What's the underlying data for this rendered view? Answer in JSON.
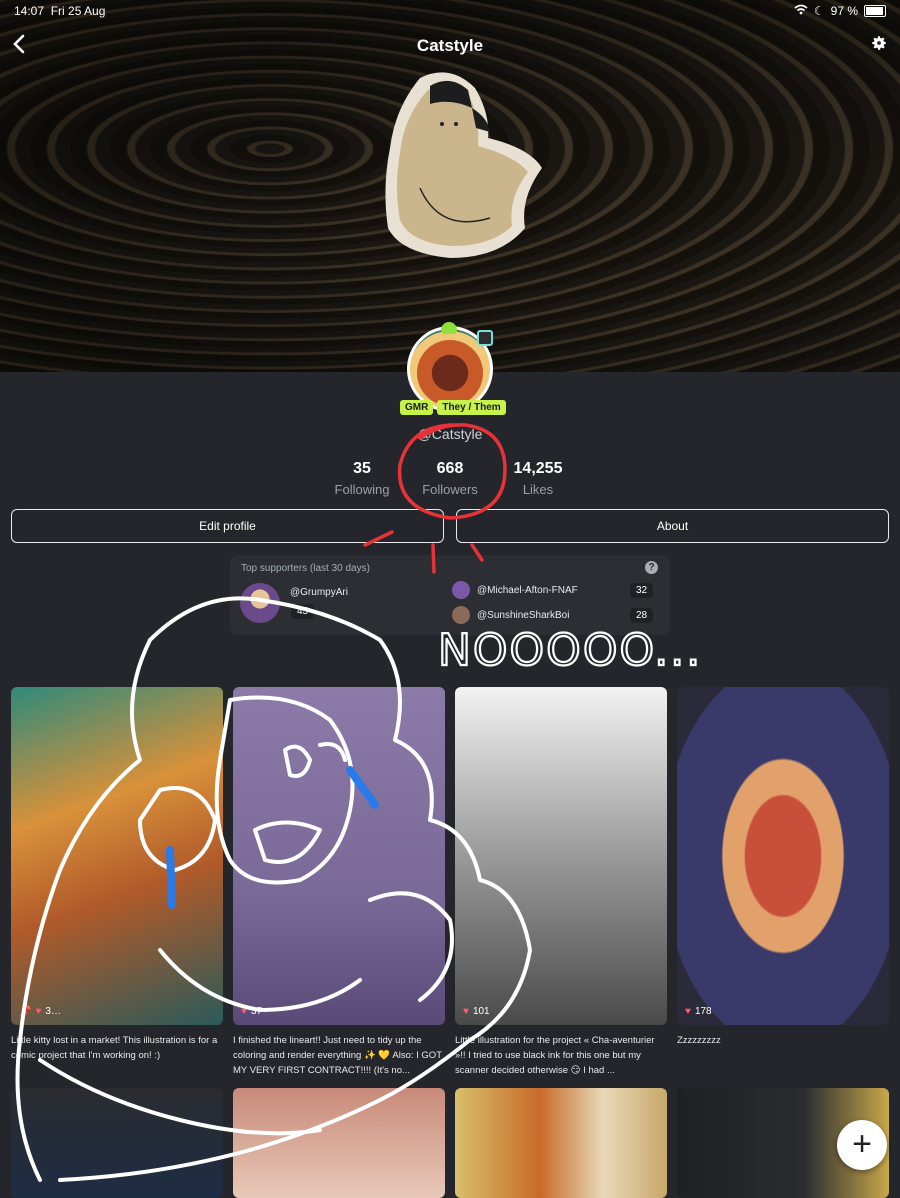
{
  "status_bar": {
    "time": "14:07",
    "date": "Fri 25 Aug",
    "battery": "97 %"
  },
  "header": {
    "title": "Catstyle"
  },
  "profile": {
    "badges": [
      "GMR",
      "They / Them"
    ],
    "username": "@Catstyle",
    "stats": [
      {
        "value": "35",
        "label": "Following"
      },
      {
        "value": "668",
        "label": "Followers"
      },
      {
        "value": "14,255",
        "label": "Likes"
      }
    ],
    "buttons": {
      "edit": "Edit profile",
      "about": "About"
    }
  },
  "supporters": {
    "title": "Top supporters (last 30 days)",
    "help": "?",
    "items": [
      {
        "name": "@GrumpyAri",
        "count": "45"
      },
      {
        "name": "@Michael-Afton-FNAF",
        "count": "32"
      },
      {
        "name": "@SunshineSharkBoi",
        "count": "28"
      }
    ]
  },
  "posts": [
    {
      "likes": "3…",
      "caption": "Little kitty lost in a market! This illustration is for a comic project that I'm working on! :)"
    },
    {
      "likes": "37",
      "caption": "I finished the lineart!! Just need to tidy up the coloring and render everything ✨ 💛 Also: I GOT MY VERY FIRST CONTRACT!!!! (It's no..."
    },
    {
      "likes": "101",
      "caption": "Little illustration for the project « Cha-aventurier »!! I tried to use black ink for this one but my scanner decided otherwise 😏 I had ..."
    },
    {
      "likes": "178",
      "caption": "Zzzzzzzzz"
    }
  ],
  "annotation": {
    "text": "NOOOOO..."
  },
  "fab": {
    "label": "+"
  },
  "colors": {
    "badge": "#c6f24a",
    "background": "#24262b",
    "heart": "#ff5a78"
  }
}
